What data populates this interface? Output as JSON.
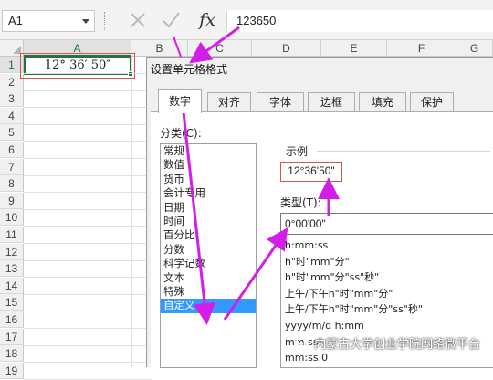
{
  "formula_bar": {
    "name_box": "A1",
    "cancel_icon": "x-icon",
    "enter_icon": "check-icon",
    "fx_label": "fx",
    "formula_value": "123650"
  },
  "sheet": {
    "columns": [
      "A",
      "B",
      "C",
      "D",
      "E",
      "F",
      "G"
    ],
    "rows": [
      "1",
      "2",
      "3",
      "4",
      "5",
      "6",
      "7",
      "8",
      "9",
      "10",
      "11",
      "12",
      "13",
      "14",
      "15",
      "16",
      "17",
      "18",
      "19"
    ],
    "active_cell_value": "12° 36′ 50″"
  },
  "dialog": {
    "title": "设置单元格格式",
    "tabs": [
      "数字",
      "对齐",
      "字体",
      "边框",
      "填充",
      "保护"
    ],
    "active_tab": "数字",
    "category_label": "分类(C):",
    "categories": [
      "常规",
      "数值",
      "货币",
      "会计专用",
      "日期",
      "时间",
      "百分比",
      "分数",
      "科学记数",
      "文本",
      "特殊",
      "自定义"
    ],
    "selected_category": "自定义",
    "sample_label": "示例",
    "sample_value": "12°36'50\"",
    "type_label": "类型(T):",
    "type_value": "0°00'00\"",
    "type_list": [
      "h:mm:ss",
      "h\"时\"mm\"分\"",
      "h\"时\"mm\"分\"ss\"秒\"",
      "上午/下午h\"时\"mm\"分\"",
      "上午/下午h\"时\"mm\"分\"ss\"秒\"",
      "yyyy/m/d h:mm",
      "mm:ss",
      "mm:ss.0"
    ]
  },
  "watermark": "内蒙古大学创业学院网络微平台",
  "colors": {
    "accent_green": "#217346",
    "arrow_magenta": "#d21ee6",
    "highlight_red": "#d9534f",
    "selection_blue": "#3399ff"
  }
}
